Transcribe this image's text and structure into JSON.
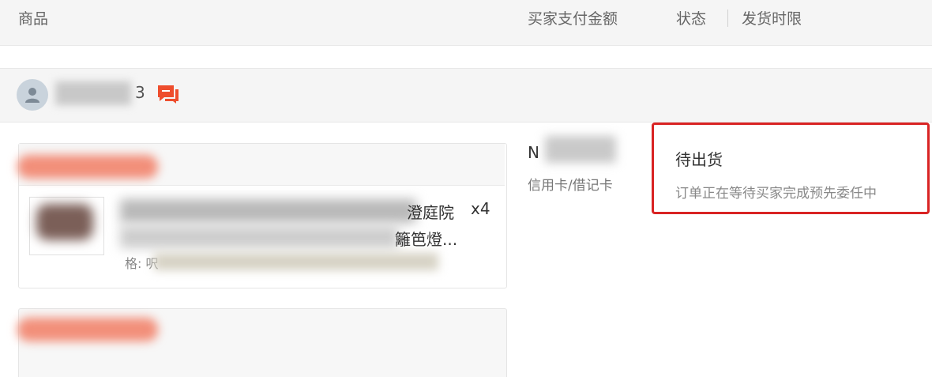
{
  "header": {
    "col_product": "商品",
    "col_payment": "买家支付金额",
    "col_status": "状态",
    "col_shipping_deadline": "发货时限"
  },
  "buyer": {
    "name_suffix": "3"
  },
  "order_item": {
    "title_line1_tail": "澄庭院",
    "title_line2_tail": "籬笆燈...",
    "quantity": "x4",
    "spec_label": "格: 呎"
  },
  "payment": {
    "amount_prefix": "N",
    "method": "信用卡/借记卡"
  },
  "status": {
    "main": "待出货",
    "detail": "订单正在等待买家完成预先委任中"
  },
  "colors": {
    "accent_red": "#d92323",
    "chat_icon": "#ee4d2d"
  }
}
